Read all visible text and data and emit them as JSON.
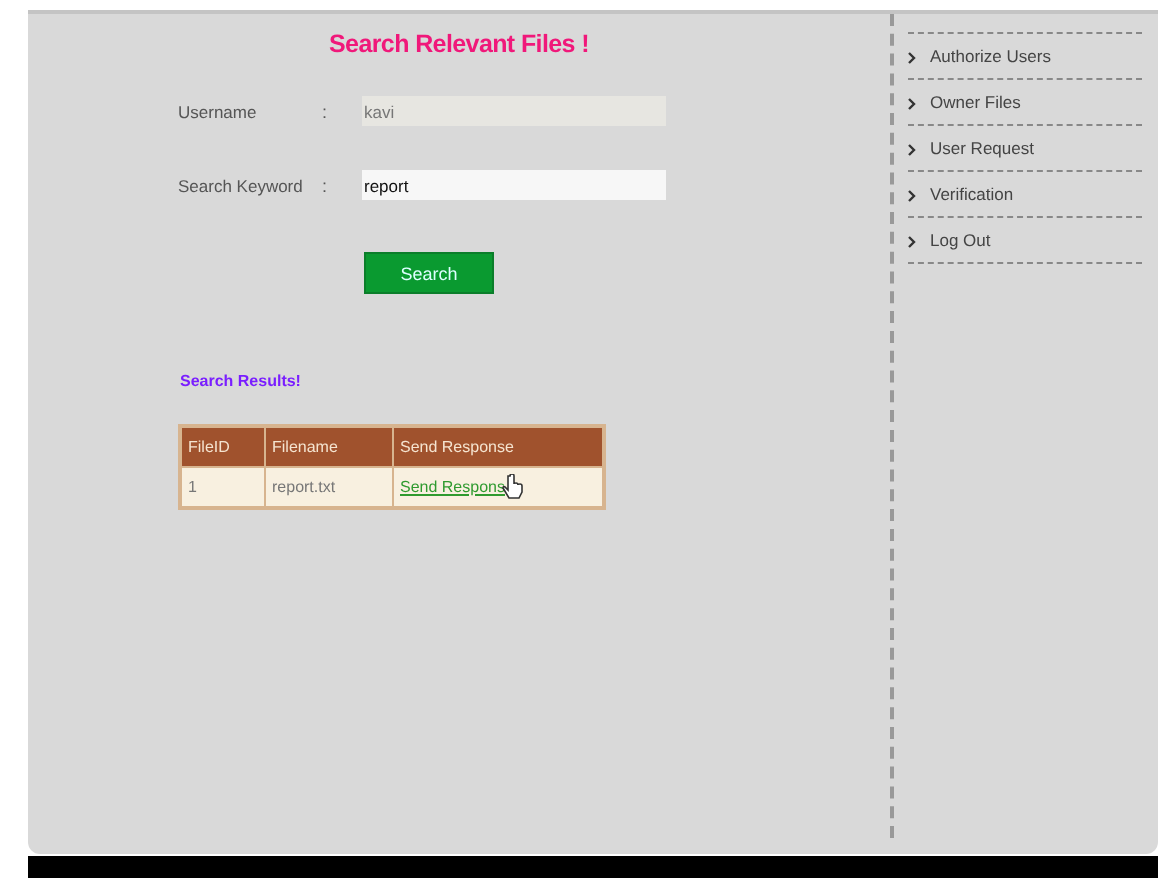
{
  "title": "Search Relevant Files !",
  "form": {
    "fields": [
      {
        "label": "Username",
        "separator": ":",
        "value": "kavi",
        "disabled": true
      },
      {
        "label": "Search Keyword",
        "separator": ":",
        "value": "report",
        "disabled": false
      }
    ],
    "button": "Search"
  },
  "results": {
    "heading": "Search Results!",
    "columns": [
      "FileID",
      "Filename",
      "Send Response"
    ],
    "rows": [
      {
        "file_id": "1",
        "filename": "report.txt",
        "link": "Send Respons"
      }
    ]
  },
  "sidebar": {
    "items": [
      {
        "label": "Authorize Users"
      },
      {
        "label": "Owner Files"
      },
      {
        "label": "User Request"
      },
      {
        "label": "Verification"
      },
      {
        "label": "Log Out"
      }
    ]
  }
}
